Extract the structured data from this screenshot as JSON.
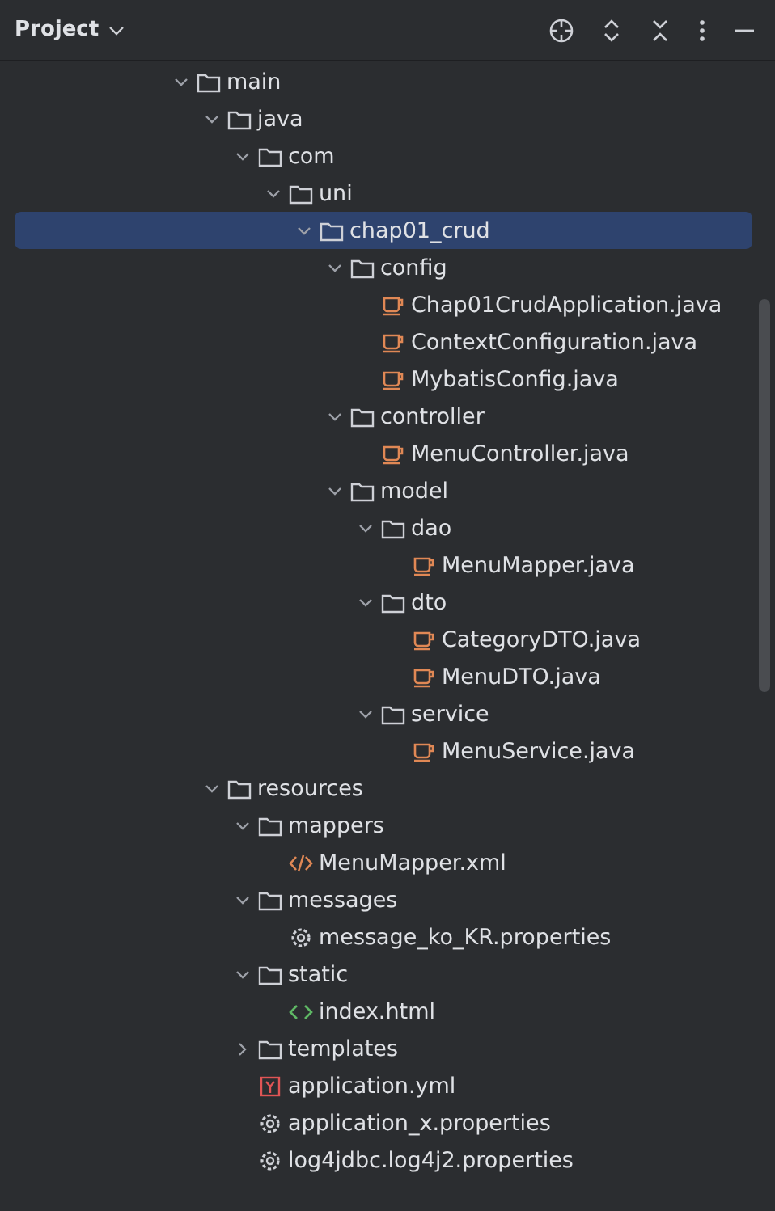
{
  "panel": {
    "title": "Project"
  },
  "tree": [
    {
      "name": "main",
      "kind": "folder",
      "expanded": true,
      "selected": false,
      "children": [
        {
          "name": "java",
          "kind": "folder",
          "expanded": true,
          "selected": false,
          "children": [
            {
              "name": "com",
              "kind": "folder",
              "expanded": true,
              "selected": false,
              "children": [
                {
                  "name": "uni",
                  "kind": "folder",
                  "expanded": true,
                  "selected": false,
                  "children": [
                    {
                      "name": "chap01_crud",
                      "kind": "folder",
                      "expanded": true,
                      "selected": true,
                      "children": [
                        {
                          "name": "config",
                          "kind": "folder",
                          "expanded": true,
                          "selected": false,
                          "children": [
                            {
                              "name": "Chap01CrudApplication.java",
                              "kind": "java",
                              "selected": false
                            },
                            {
                              "name": "ContextConfiguration.java",
                              "kind": "java",
                              "selected": false
                            },
                            {
                              "name": "MybatisConfig.java",
                              "kind": "java",
                              "selected": false
                            }
                          ]
                        },
                        {
                          "name": "controller",
                          "kind": "folder",
                          "expanded": true,
                          "selected": false,
                          "children": [
                            {
                              "name": "MenuController.java",
                              "kind": "java",
                              "selected": false
                            }
                          ]
                        },
                        {
                          "name": "model",
                          "kind": "folder",
                          "expanded": true,
                          "selected": false,
                          "children": [
                            {
                              "name": "dao",
                              "kind": "folder",
                              "expanded": true,
                              "selected": false,
                              "children": [
                                {
                                  "name": "MenuMapper.java",
                                  "kind": "java",
                                  "selected": false
                                }
                              ]
                            },
                            {
                              "name": "dto",
                              "kind": "folder",
                              "expanded": true,
                              "selected": false,
                              "children": [
                                {
                                  "name": "CategoryDTO.java",
                                  "kind": "java",
                                  "selected": false
                                },
                                {
                                  "name": "MenuDTO.java",
                                  "kind": "java",
                                  "selected": false
                                }
                              ]
                            },
                            {
                              "name": "service",
                              "kind": "folder",
                              "expanded": true,
                              "selected": false,
                              "children": [
                                {
                                  "name": "MenuService.java",
                                  "kind": "java",
                                  "selected": false
                                }
                              ]
                            }
                          ]
                        }
                      ]
                    }
                  ]
                }
              ]
            }
          ]
        },
        {
          "name": "resources",
          "kind": "folder",
          "expanded": true,
          "selected": false,
          "children": [
            {
              "name": "mappers",
              "kind": "folder",
              "expanded": true,
              "selected": false,
              "children": [
                {
                  "name": "MenuMapper.xml",
                  "kind": "xml",
                  "selected": false
                }
              ]
            },
            {
              "name": "messages",
              "kind": "folder",
              "expanded": true,
              "selected": false,
              "children": [
                {
                  "name": "message_ko_KR.properties",
                  "kind": "properties",
                  "selected": false
                }
              ]
            },
            {
              "name": "static",
              "kind": "folder",
              "expanded": true,
              "selected": false,
              "children": [
                {
                  "name": "index.html",
                  "kind": "html",
                  "selected": false
                }
              ]
            },
            {
              "name": "templates",
              "kind": "folder",
              "expanded": false,
              "selected": false
            },
            {
              "name": "application.yml",
              "kind": "yml",
              "selected": false
            },
            {
              "name": "application_x.properties",
              "kind": "properties",
              "selected": false
            },
            {
              "name": "log4jdbc.log4j2.properties",
              "kind": "properties",
              "selected": false
            }
          ]
        }
      ]
    }
  ]
}
